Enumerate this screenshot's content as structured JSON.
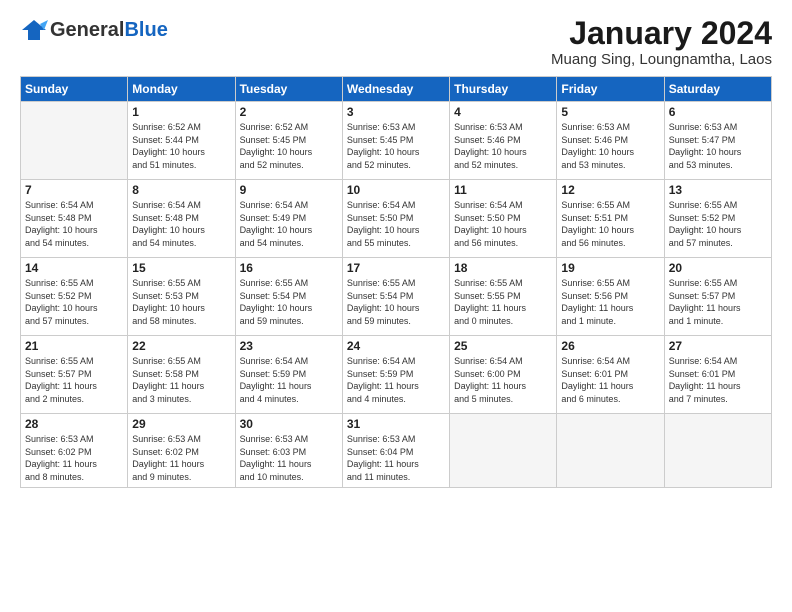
{
  "logo": {
    "general": "General",
    "blue": "Blue"
  },
  "header": {
    "title": "January 2024",
    "subtitle": "Muang Sing, Loungnamtha, Laos"
  },
  "weekdays": [
    "Sunday",
    "Monday",
    "Tuesday",
    "Wednesday",
    "Thursday",
    "Friday",
    "Saturday"
  ],
  "weeks": [
    [
      {
        "day": "",
        "info": ""
      },
      {
        "day": "1",
        "info": "Sunrise: 6:52 AM\nSunset: 5:44 PM\nDaylight: 10 hours\nand 51 minutes."
      },
      {
        "day": "2",
        "info": "Sunrise: 6:52 AM\nSunset: 5:45 PM\nDaylight: 10 hours\nand 52 minutes."
      },
      {
        "day": "3",
        "info": "Sunrise: 6:53 AM\nSunset: 5:45 PM\nDaylight: 10 hours\nand 52 minutes."
      },
      {
        "day": "4",
        "info": "Sunrise: 6:53 AM\nSunset: 5:46 PM\nDaylight: 10 hours\nand 52 minutes."
      },
      {
        "day": "5",
        "info": "Sunrise: 6:53 AM\nSunset: 5:46 PM\nDaylight: 10 hours\nand 53 minutes."
      },
      {
        "day": "6",
        "info": "Sunrise: 6:53 AM\nSunset: 5:47 PM\nDaylight: 10 hours\nand 53 minutes."
      }
    ],
    [
      {
        "day": "7",
        "info": "Sunrise: 6:54 AM\nSunset: 5:48 PM\nDaylight: 10 hours\nand 54 minutes."
      },
      {
        "day": "8",
        "info": "Sunrise: 6:54 AM\nSunset: 5:48 PM\nDaylight: 10 hours\nand 54 minutes."
      },
      {
        "day": "9",
        "info": "Sunrise: 6:54 AM\nSunset: 5:49 PM\nDaylight: 10 hours\nand 54 minutes."
      },
      {
        "day": "10",
        "info": "Sunrise: 6:54 AM\nSunset: 5:50 PM\nDaylight: 10 hours\nand 55 minutes."
      },
      {
        "day": "11",
        "info": "Sunrise: 6:54 AM\nSunset: 5:50 PM\nDaylight: 10 hours\nand 56 minutes."
      },
      {
        "day": "12",
        "info": "Sunrise: 6:55 AM\nSunset: 5:51 PM\nDaylight: 10 hours\nand 56 minutes."
      },
      {
        "day": "13",
        "info": "Sunrise: 6:55 AM\nSunset: 5:52 PM\nDaylight: 10 hours\nand 57 minutes."
      }
    ],
    [
      {
        "day": "14",
        "info": "Sunrise: 6:55 AM\nSunset: 5:52 PM\nDaylight: 10 hours\nand 57 minutes."
      },
      {
        "day": "15",
        "info": "Sunrise: 6:55 AM\nSunset: 5:53 PM\nDaylight: 10 hours\nand 58 minutes."
      },
      {
        "day": "16",
        "info": "Sunrise: 6:55 AM\nSunset: 5:54 PM\nDaylight: 10 hours\nand 59 minutes."
      },
      {
        "day": "17",
        "info": "Sunrise: 6:55 AM\nSunset: 5:54 PM\nDaylight: 10 hours\nand 59 minutes."
      },
      {
        "day": "18",
        "info": "Sunrise: 6:55 AM\nSunset: 5:55 PM\nDaylight: 11 hours\nand 0 minutes."
      },
      {
        "day": "19",
        "info": "Sunrise: 6:55 AM\nSunset: 5:56 PM\nDaylight: 11 hours\nand 1 minute."
      },
      {
        "day": "20",
        "info": "Sunrise: 6:55 AM\nSunset: 5:57 PM\nDaylight: 11 hours\nand 1 minute."
      }
    ],
    [
      {
        "day": "21",
        "info": "Sunrise: 6:55 AM\nSunset: 5:57 PM\nDaylight: 11 hours\nand 2 minutes."
      },
      {
        "day": "22",
        "info": "Sunrise: 6:55 AM\nSunset: 5:58 PM\nDaylight: 11 hours\nand 3 minutes."
      },
      {
        "day": "23",
        "info": "Sunrise: 6:54 AM\nSunset: 5:59 PM\nDaylight: 11 hours\nand 4 minutes."
      },
      {
        "day": "24",
        "info": "Sunrise: 6:54 AM\nSunset: 5:59 PM\nDaylight: 11 hours\nand 4 minutes."
      },
      {
        "day": "25",
        "info": "Sunrise: 6:54 AM\nSunset: 6:00 PM\nDaylight: 11 hours\nand 5 minutes."
      },
      {
        "day": "26",
        "info": "Sunrise: 6:54 AM\nSunset: 6:01 PM\nDaylight: 11 hours\nand 6 minutes."
      },
      {
        "day": "27",
        "info": "Sunrise: 6:54 AM\nSunset: 6:01 PM\nDaylight: 11 hours\nand 7 minutes."
      }
    ],
    [
      {
        "day": "28",
        "info": "Sunrise: 6:53 AM\nSunset: 6:02 PM\nDaylight: 11 hours\nand 8 minutes."
      },
      {
        "day": "29",
        "info": "Sunrise: 6:53 AM\nSunset: 6:02 PM\nDaylight: 11 hours\nand 9 minutes."
      },
      {
        "day": "30",
        "info": "Sunrise: 6:53 AM\nSunset: 6:03 PM\nDaylight: 11 hours\nand 10 minutes."
      },
      {
        "day": "31",
        "info": "Sunrise: 6:53 AM\nSunset: 6:04 PM\nDaylight: 11 hours\nand 11 minutes."
      },
      {
        "day": "",
        "info": ""
      },
      {
        "day": "",
        "info": ""
      },
      {
        "day": "",
        "info": ""
      }
    ]
  ]
}
